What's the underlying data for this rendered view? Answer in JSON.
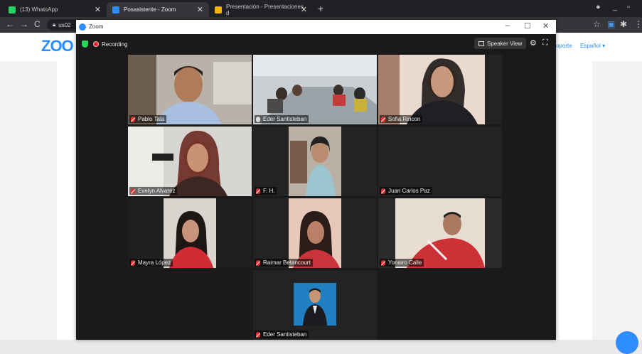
{
  "browser": {
    "tabs": [
      {
        "label": "(13) WhatsApp",
        "color": "#25d366"
      },
      {
        "label": "Posasistente - Zoom",
        "color": "#2d8cff"
      },
      {
        "label": "Presentación - Presentaciones d",
        "color": "#f4b400"
      }
    ],
    "new_tab": "+",
    "address": "us02",
    "nav": {
      "back": "←",
      "forward": "→",
      "reload": "C"
    }
  },
  "webpage": {
    "logo": "ZOO",
    "links": [
      "oporte",
      "Español ▾"
    ]
  },
  "zoom_window": {
    "title": "Zoom",
    "controls": {
      "minimize": "–",
      "maximize": "☐",
      "close": "✕"
    },
    "recording_label": "Recording",
    "speaker_view_label": "Speaker View"
  },
  "participants": [
    {
      "name": "Pablo Tala",
      "muted": true,
      "speaking": false
    },
    {
      "name": "Eder Santisteban",
      "muted": false,
      "speaking": true
    },
    {
      "name": "Sofia Rincon",
      "muted": true,
      "speaking": false
    },
    {
      "name": "Evelyn Alvarez",
      "muted": true,
      "speaking": false
    },
    {
      "name": "F. H.",
      "muted": true,
      "speaking": false
    },
    {
      "name": "Juan Carlos Paz",
      "muted": true,
      "speaking": false
    },
    {
      "name": "Mayra López",
      "muted": true,
      "speaking": false
    },
    {
      "name": "Raimar Betancourt",
      "muted": true,
      "speaking": false
    },
    {
      "name": "Yonairo Calle",
      "muted": true,
      "speaking": false
    },
    {
      "name": "Eder Santisteban",
      "muted": true,
      "speaking": false
    }
  ]
}
